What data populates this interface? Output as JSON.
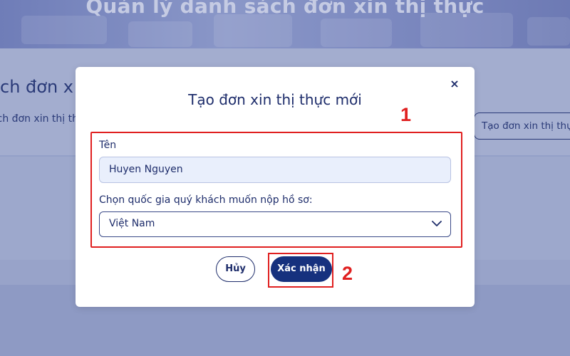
{
  "background": {
    "hero_title": "Quản lý danh sách đơn xin thị thực",
    "heading_fragment": "ch đơn x",
    "sub_fragment": "ch đơn xin thị th",
    "create_button_label": "Tạo đơn xin thị thực"
  },
  "modal": {
    "title": "Tạo đơn xin thị thực mới",
    "close_symbol": "×",
    "name_label": "Tên",
    "name_value": "Huyen Nguyen",
    "country_label": "Chọn quốc gia quý khách muốn nộp hồ sơ:",
    "country_selected": "Việt Nam",
    "cancel_label": "Hủy",
    "confirm_label": "Xác nhận"
  },
  "annotations": {
    "step1": "1",
    "step2": "2",
    "highlight_color": "#e02020"
  },
  "colors": {
    "primary": "#16317e",
    "text_dark": "#1e2d6b",
    "input_bg": "#e9effc"
  },
  "icons": {
    "close": "close-icon",
    "dropdown": "chevron-down-icon"
  }
}
